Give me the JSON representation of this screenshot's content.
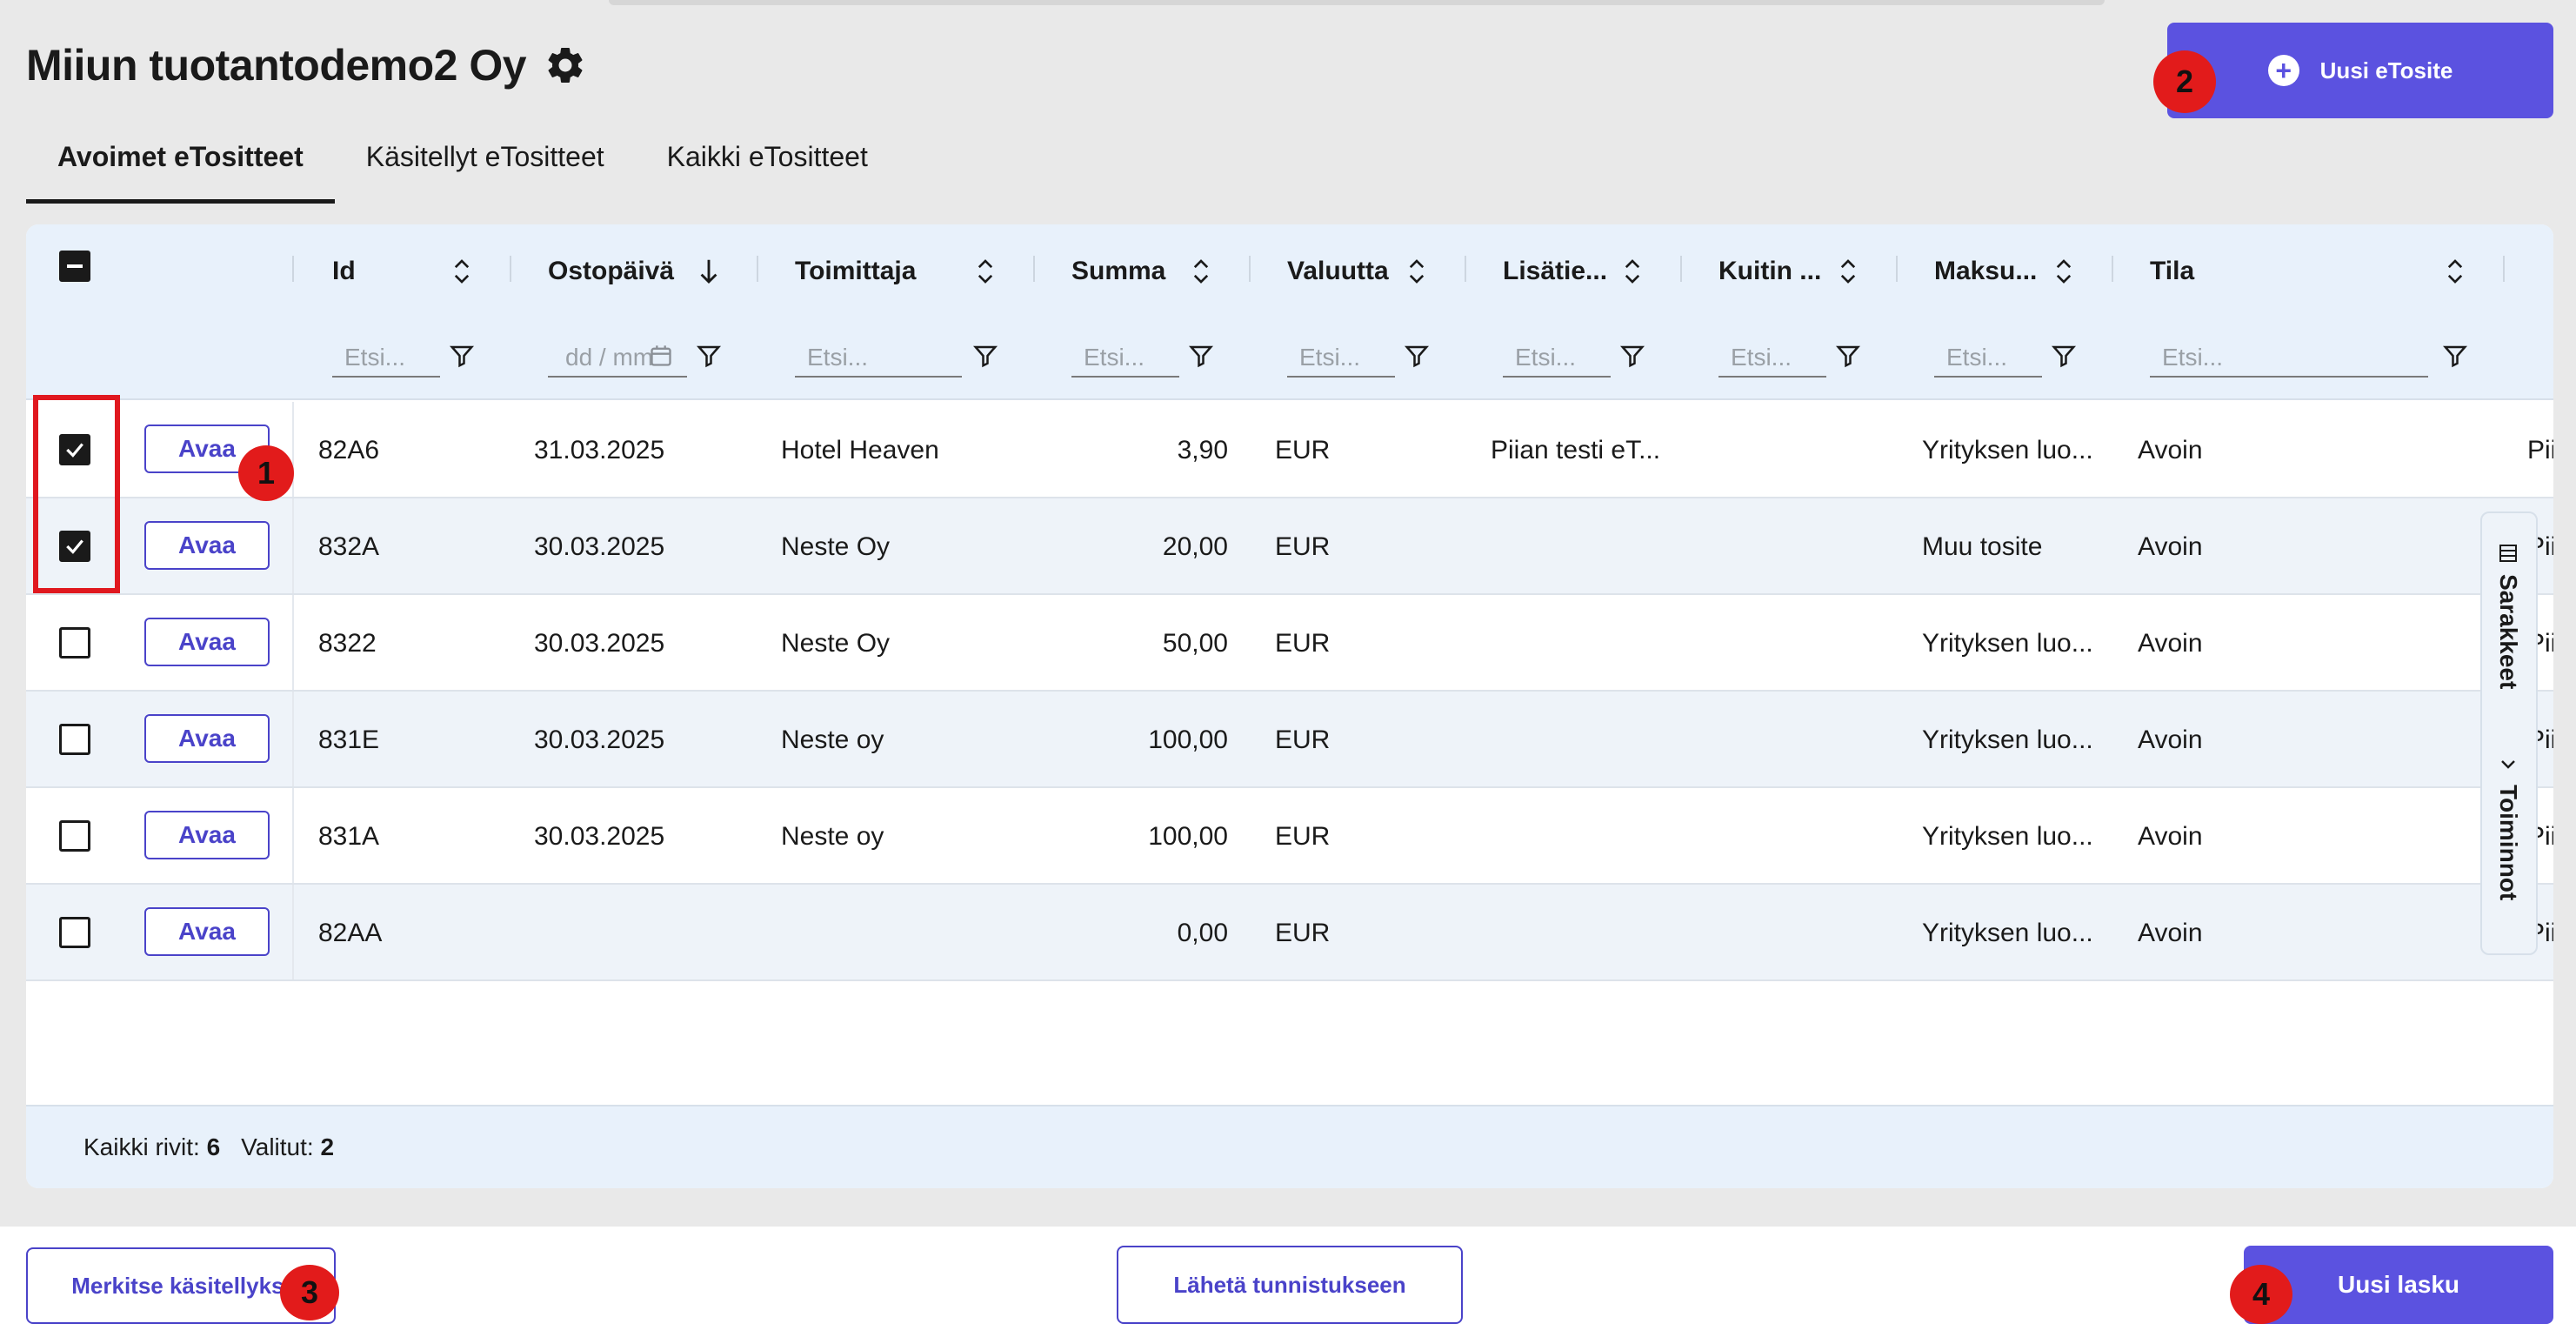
{
  "page": {
    "title": "Miiun tuotantodemo2 Oy",
    "settings_icon": "gear-icon"
  },
  "header": {
    "new_receipt_label": "Uusi eTosite",
    "new_receipt_icon": "plus-circle-icon"
  },
  "tabs": [
    {
      "label": "Avoimet eTositteet",
      "active": true
    },
    {
      "label": "Käsitellyt eTositteet",
      "active": false
    },
    {
      "label": "Kaikki eTositteet",
      "active": false
    }
  ],
  "table": {
    "columns": [
      {
        "label": "Id",
        "filter_placeholder": "Etsi..."
      },
      {
        "label": "Ostopäivä",
        "filter_placeholder": "dd / mm"
      },
      {
        "label": "Toimittaja",
        "filter_placeholder": "Etsi..."
      },
      {
        "label": "Summa",
        "filter_placeholder": "Etsi..."
      },
      {
        "label": "Valuutta",
        "filter_placeholder": "Etsi..."
      },
      {
        "label": "Lisätie...",
        "filter_placeholder": "Etsi..."
      },
      {
        "label": "Kuitin ...",
        "filter_placeholder": "Etsi..."
      },
      {
        "label": "Maksu...",
        "filter_placeholder": "Etsi..."
      },
      {
        "label": "Tila",
        "filter_placeholder": "Etsi..."
      }
    ],
    "open_label": "Avaa",
    "rows": [
      {
        "checked": true,
        "id": "82A6",
        "date": "31.03.2025",
        "supplier": "Hotel Heaven",
        "amount": "3,90",
        "currency": "EUR",
        "extra": "Piian testi eT...",
        "receipt": "",
        "payment": "Yrityksen luo...",
        "status": "Avoin",
        "overflow": "Pii"
      },
      {
        "checked": true,
        "id": "832A",
        "date": "30.03.2025",
        "supplier": "Neste Oy",
        "amount": "20,00",
        "currency": "EUR",
        "extra": "",
        "receipt": "",
        "payment": "Muu tosite",
        "status": "Avoin",
        "overflow": "Pii"
      },
      {
        "checked": false,
        "id": "8322",
        "date": "30.03.2025",
        "supplier": "Neste Oy",
        "amount": "50,00",
        "currency": "EUR",
        "extra": "",
        "receipt": "",
        "payment": "Yrityksen luo...",
        "status": "Avoin",
        "overflow": "Pii"
      },
      {
        "checked": false,
        "id": "831E",
        "date": "30.03.2025",
        "supplier": "Neste oy",
        "amount": "100,00",
        "currency": "EUR",
        "extra": "",
        "receipt": "",
        "payment": "Yrityksen luo...",
        "status": "Avoin",
        "overflow": "Pii"
      },
      {
        "checked": false,
        "id": "831A",
        "date": "30.03.2025",
        "supplier": "Neste oy",
        "amount": "100,00",
        "currency": "EUR",
        "extra": "",
        "receipt": "",
        "payment": "Yrityksen luo...",
        "status": "Avoin",
        "overflow": "Pii"
      },
      {
        "checked": false,
        "id": "82AA",
        "date": "",
        "supplier": "",
        "amount": "0,00",
        "currency": "EUR",
        "extra": "",
        "receipt": "",
        "payment": "Yrityksen luo...",
        "status": "Avoin",
        "overflow": "Pii"
      }
    ],
    "footer": {
      "total_label": "Kaikki rivit:",
      "total_value": "6",
      "selected_label": "Valitut:",
      "selected_value": "2"
    }
  },
  "side_panel": {
    "columns_label": "Sarakkeet",
    "actions_label": "Toiminnot"
  },
  "bottom": {
    "mark_processed_label": "Merkitse käsitellyksi",
    "send_label": "Lähetä tunnistukseen",
    "new_invoice_label": "Uusi lasku"
  },
  "annotations": [
    "1",
    "2",
    "3",
    "4"
  ],
  "colors": {
    "accent": "#5b52e0",
    "annotation": "#e21b1b"
  }
}
